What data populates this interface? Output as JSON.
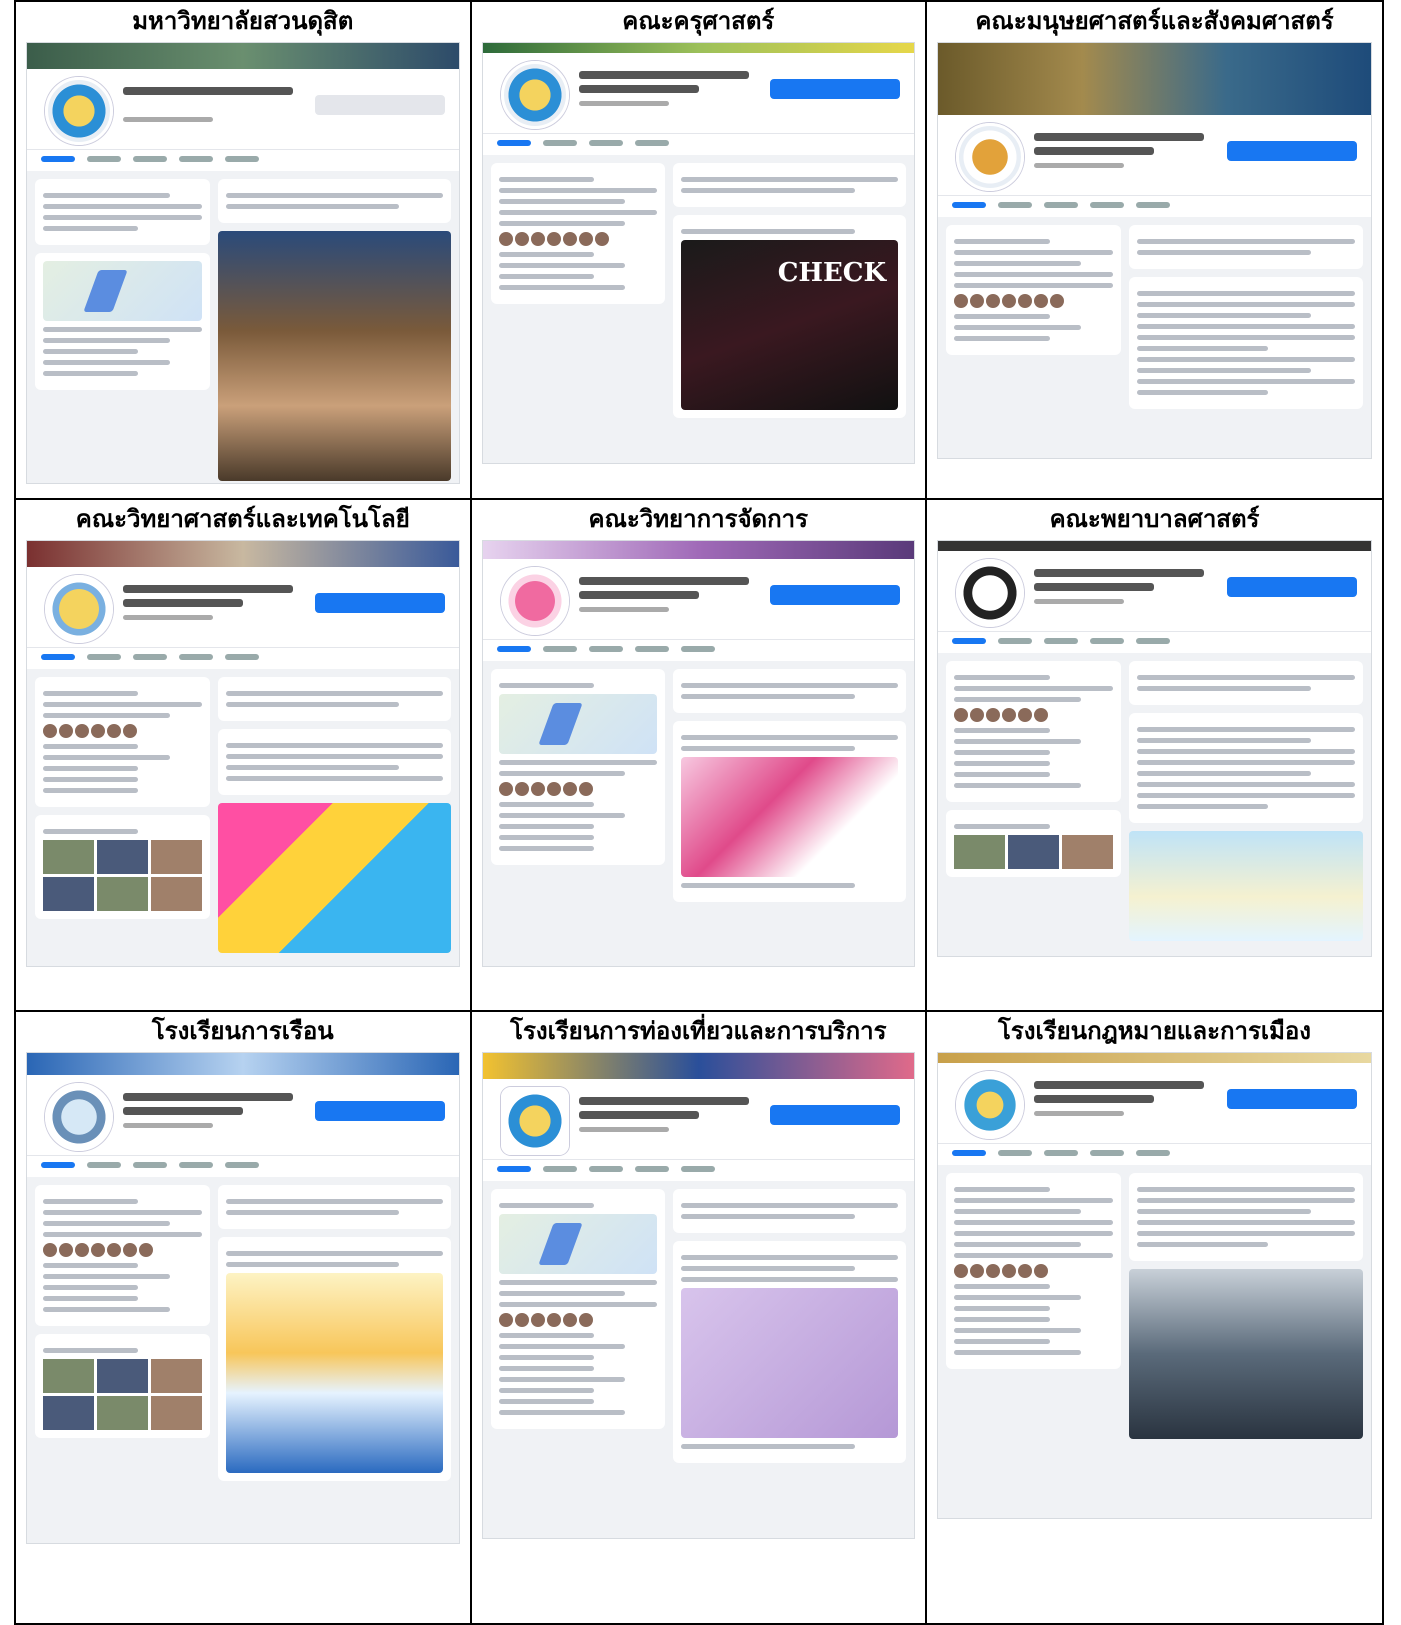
{
  "cells": [
    {
      "title": "มหาวิทยาลัยสวนดุสิต"
    },
    {
      "title": "คณะครุศาสตร์"
    },
    {
      "title": "คณะมนุษยศาสตร์และสังคมศาสตร์"
    },
    {
      "title": "คณะวิทยาศาสตร์และเทคโนโลยี"
    },
    {
      "title": "คณะวิทยาการจัดการ"
    },
    {
      "title": "คณะพยาบาลศาสตร์"
    },
    {
      "title": "โรงเรียนการเรือน"
    },
    {
      "title": "โรงเรียนการท่องเที่ยวและการบริการ"
    },
    {
      "title": "โรงเรียนกฎหมายและการเมือง"
    }
  ]
}
